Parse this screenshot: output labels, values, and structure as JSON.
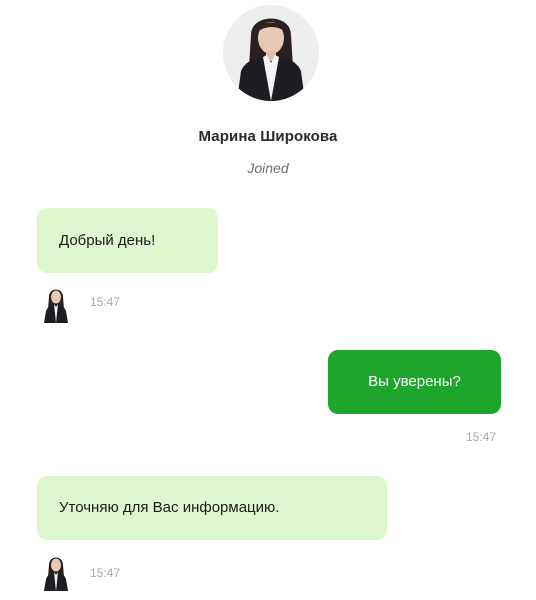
{
  "contact": {
    "name": "Марина Широкова",
    "status": "Joined"
  },
  "messages": [
    {
      "direction": "incoming",
      "text": "Добрый день!",
      "time": "15:47"
    },
    {
      "direction": "outgoing",
      "text": "Вы уверены?",
      "time": "15:47"
    },
    {
      "direction": "incoming",
      "text": "Уточняю для Вас информацию.",
      "time": "15:47"
    }
  ],
  "colors": {
    "incoming_bubble": "#dff7cf",
    "outgoing_bubble": "#1ea52b",
    "outgoing_text": "#ffffff",
    "timestamp": "#a8a8a8"
  },
  "icons": {
    "profile_avatar": "person-photo",
    "message_avatar": "person-photo-small"
  }
}
